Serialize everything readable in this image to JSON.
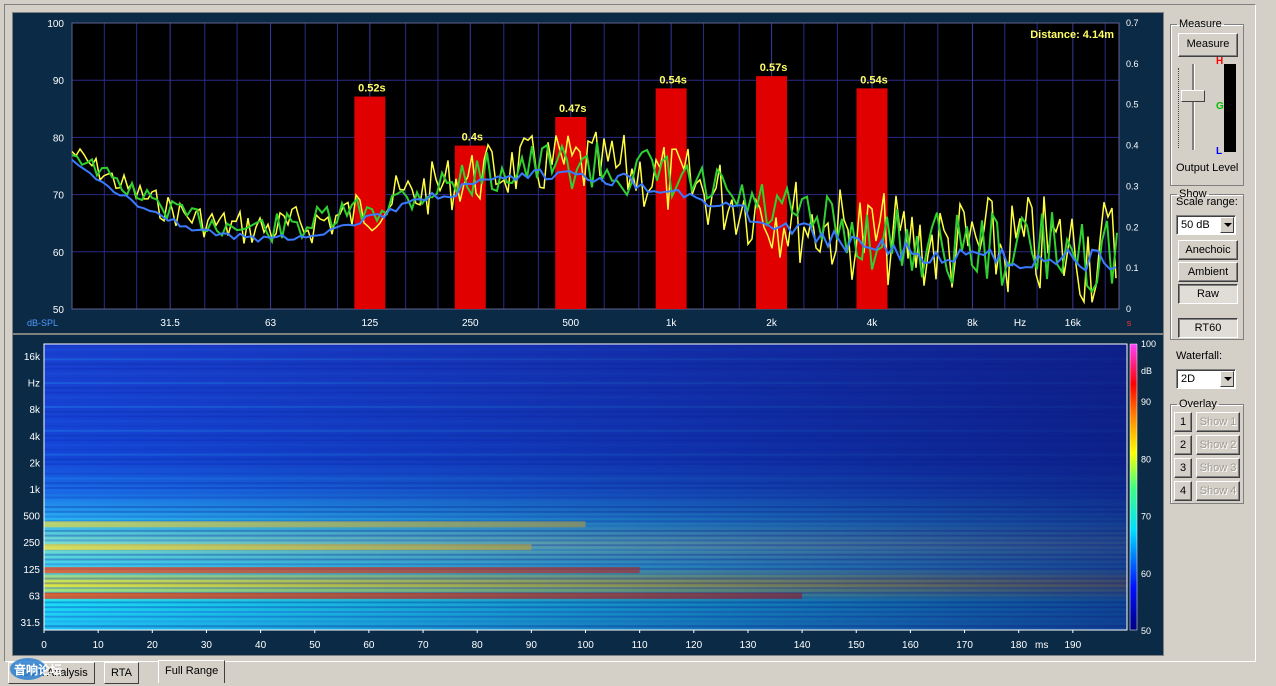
{
  "top_chart": {
    "distance": "Distance: 4.14m",
    "y_unit": "dB-SPL",
    "x_unit": "Hz",
    "r_unit": "s",
    "y_ticks": [
      "100",
      "90",
      "80",
      "70",
      "60",
      "50"
    ],
    "r_ticks": [
      "0.7",
      "0.6",
      "0.5",
      "0.4",
      "0.3",
      "0.2",
      "0.1",
      "0"
    ],
    "x_ticks": [
      "31.5",
      "63",
      "125",
      "250",
      "500",
      "1k",
      "2k",
      "4k",
      "8k",
      "16k"
    ]
  },
  "chart_data": {
    "type": "bar",
    "categories": [
      "125",
      "250",
      "500",
      "1k",
      "2k",
      "4k"
    ],
    "values": [
      0.52,
      0.4,
      0.47,
      0.54,
      0.57,
      0.54
    ],
    "labels": [
      "0.52s",
      "0.4s",
      "0.47s",
      "0.54s",
      "0.57s",
      "0.54s"
    ],
    "ylabel": "s",
    "ylim": [
      0,
      0.7
    ]
  },
  "bottom_chart": {
    "y_ticks": [
      "16k",
      "Hz",
      "8k",
      "4k",
      "2k",
      "1k",
      "500",
      "250",
      "125",
      "63",
      "31.5"
    ],
    "x_ticks": [
      "0",
      "10",
      "20",
      "30",
      "40",
      "50",
      "60",
      "70",
      "80",
      "90",
      "100",
      "110",
      "120",
      "130",
      "140",
      "150",
      "160",
      "170",
      "180",
      "190"
    ],
    "x_unit": "ms",
    "scale_ticks": [
      "100",
      "dB",
      "90",
      "80",
      "70",
      "60",
      "50"
    ]
  },
  "controls": {
    "measure_group": "Measure",
    "measure_button": "Measure",
    "meter_h": "H",
    "meter_g": "G",
    "meter_l": "L",
    "output_level": "Output Level",
    "show_group": "Show",
    "scale_range_label": "Scale range:",
    "scale_range_value": "50 dB",
    "anechoic": "Anechoic",
    "ambient": "Ambient",
    "raw": "Raw",
    "rt60": "RT60",
    "waterfall_label": "Waterfall:",
    "waterfall_value": "2D",
    "overlay_group": "Overlay",
    "overlays": [
      {
        "num": "1",
        "show": "Show 1"
      },
      {
        "num": "2",
        "show": "Show 2"
      },
      {
        "num": "3",
        "show": "Show 3"
      },
      {
        "num": "4",
        "show": "Show 4"
      }
    ]
  },
  "tabs": {
    "room_analysis": "Room Analysis",
    "rta": "RTA",
    "full_range": "Full Range"
  },
  "watermark": "音响论坛"
}
